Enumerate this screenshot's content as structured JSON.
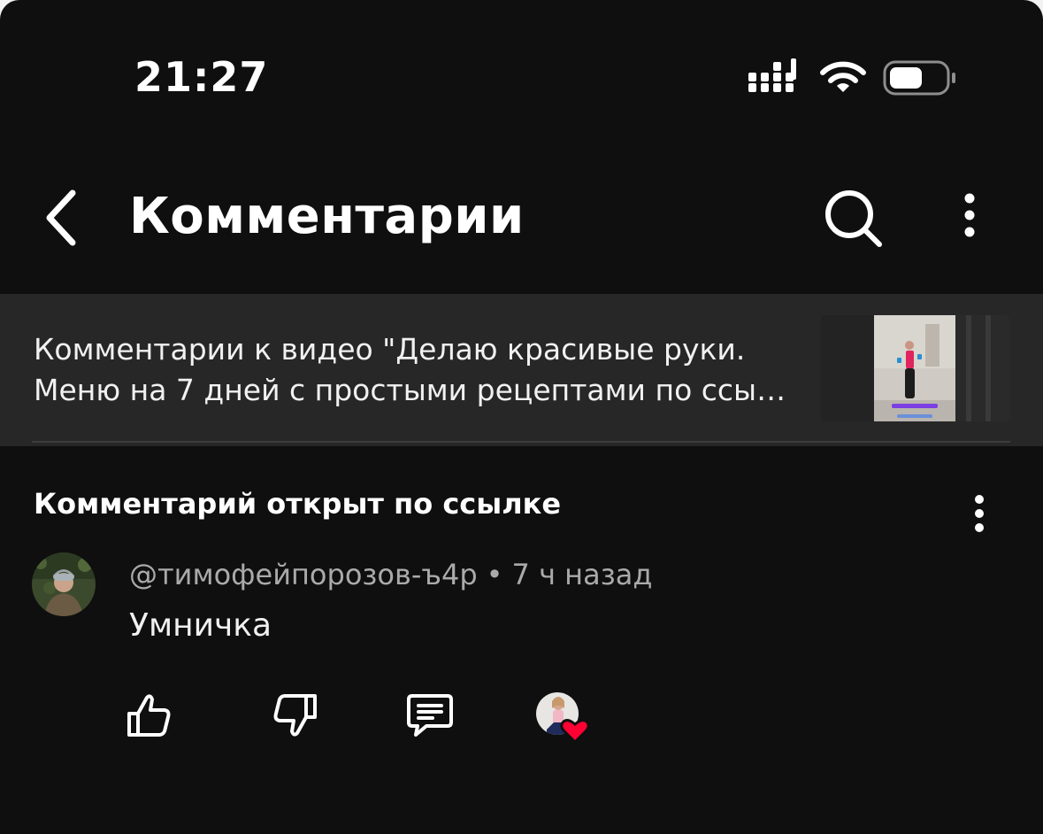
{
  "status_bar": {
    "time": "21:27",
    "icons": [
      "signal-icon",
      "wifi-icon",
      "battery-icon"
    ]
  },
  "header": {
    "title": "Комментарии",
    "icons": [
      "back-arrow-icon",
      "search-icon",
      "more-vertical-icon"
    ]
  },
  "video": {
    "caption": "Комментарии к видео \"Делаю красивые руки. Меню на 7 дней с простыми рецептами по ссы…"
  },
  "section": {
    "title": "Комментарий открыт по ссылке"
  },
  "comment": {
    "author": "@тимофейпорозов-ъ4р",
    "separator": "•",
    "time": "7 ч назад",
    "text": "Умничка",
    "actions": [
      "thumbs-up-icon",
      "thumbs-down-icon",
      "reply-icon",
      "creator-heart-icon"
    ]
  },
  "colors": {
    "background": "#0f0f0f",
    "banner": "#272727",
    "secondary_text": "#aaaaaa",
    "heart": "#ff0033"
  }
}
